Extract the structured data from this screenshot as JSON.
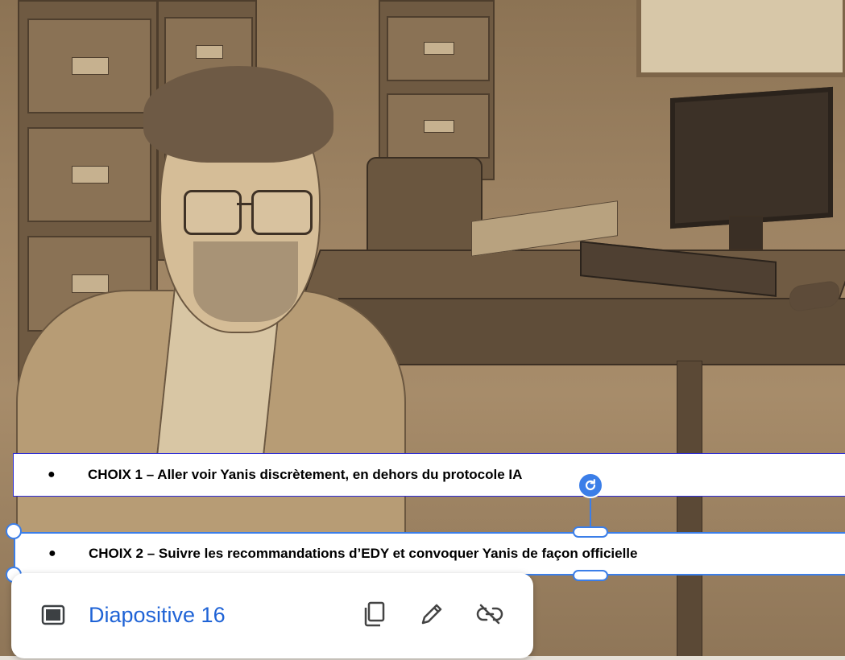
{
  "choices": [
    {
      "bullet": "●",
      "text": "CHOIX 1 – Aller voir Yanis discrètement, en dehors du protocole IA"
    },
    {
      "bullet": "●",
      "text": "CHOIX 2 – Suivre les recommandations d’EDY et convoquer Yanis de façon officielle"
    }
  ],
  "link_toolbar": {
    "link_label": "Diapositive 16",
    "slide_icon": "slide-icon",
    "copy_icon": "copy-icon",
    "edit_icon": "pencil-icon",
    "unlink_icon": "unlink-icon"
  },
  "colors": {
    "link": "#1f63d6",
    "selection": "#3b7ee8",
    "choice1_border": "#2b2bd8"
  }
}
